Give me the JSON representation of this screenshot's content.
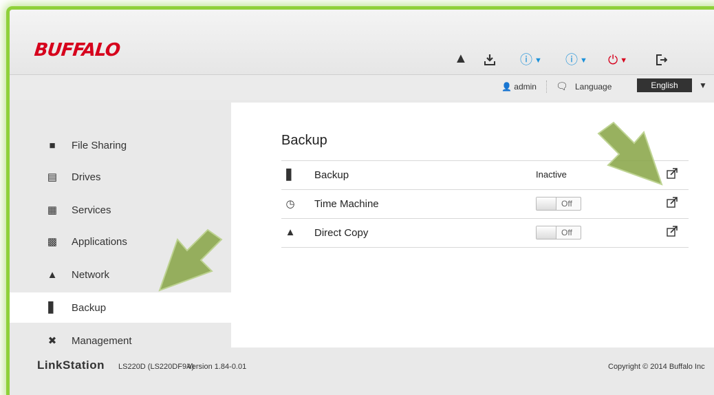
{
  "header": {
    "logo": "BUFFALO",
    "icons": [
      "home-icon",
      "download-icon",
      "help-icon",
      "info-icon",
      "power-icon",
      "logout-icon"
    ],
    "colors": {
      "logo": "#d6001c",
      "help": "#1a90d9",
      "info": "#1a90d9",
      "power": "#d6001c",
      "highlight": "#8fd13a"
    }
  },
  "subbar": {
    "user": "admin",
    "language_label": "Language",
    "language_value": "English"
  },
  "sidebar": {
    "items": [
      {
        "label": "File Sharing",
        "icon": "folder-icon"
      },
      {
        "label": "Drives",
        "icon": "drive-icon"
      },
      {
        "label": "Services",
        "icon": "services-icon"
      },
      {
        "label": "Applications",
        "icon": "applications-icon"
      },
      {
        "label": "Network",
        "icon": "network-icon"
      },
      {
        "label": "Backup",
        "icon": "backup-icon",
        "active": true
      },
      {
        "label": "Management",
        "icon": "management-icon"
      }
    ]
  },
  "content": {
    "title": "Backup",
    "rows": [
      {
        "name": "Backup",
        "status": "Inactive",
        "icon": "backup-icon"
      },
      {
        "name": "Time Machine",
        "toggle": "Off",
        "icon": "time-machine-icon"
      },
      {
        "name": "Direct Copy",
        "toggle": "Off",
        "icon": "direct-copy-icon"
      }
    ]
  },
  "footer": {
    "brand": "LinkStation",
    "model": "LS220D (LS220DF9A)",
    "version": "Version 1.84-0.01",
    "copyright": "Copyright © 2014 Buffalo Inc"
  }
}
